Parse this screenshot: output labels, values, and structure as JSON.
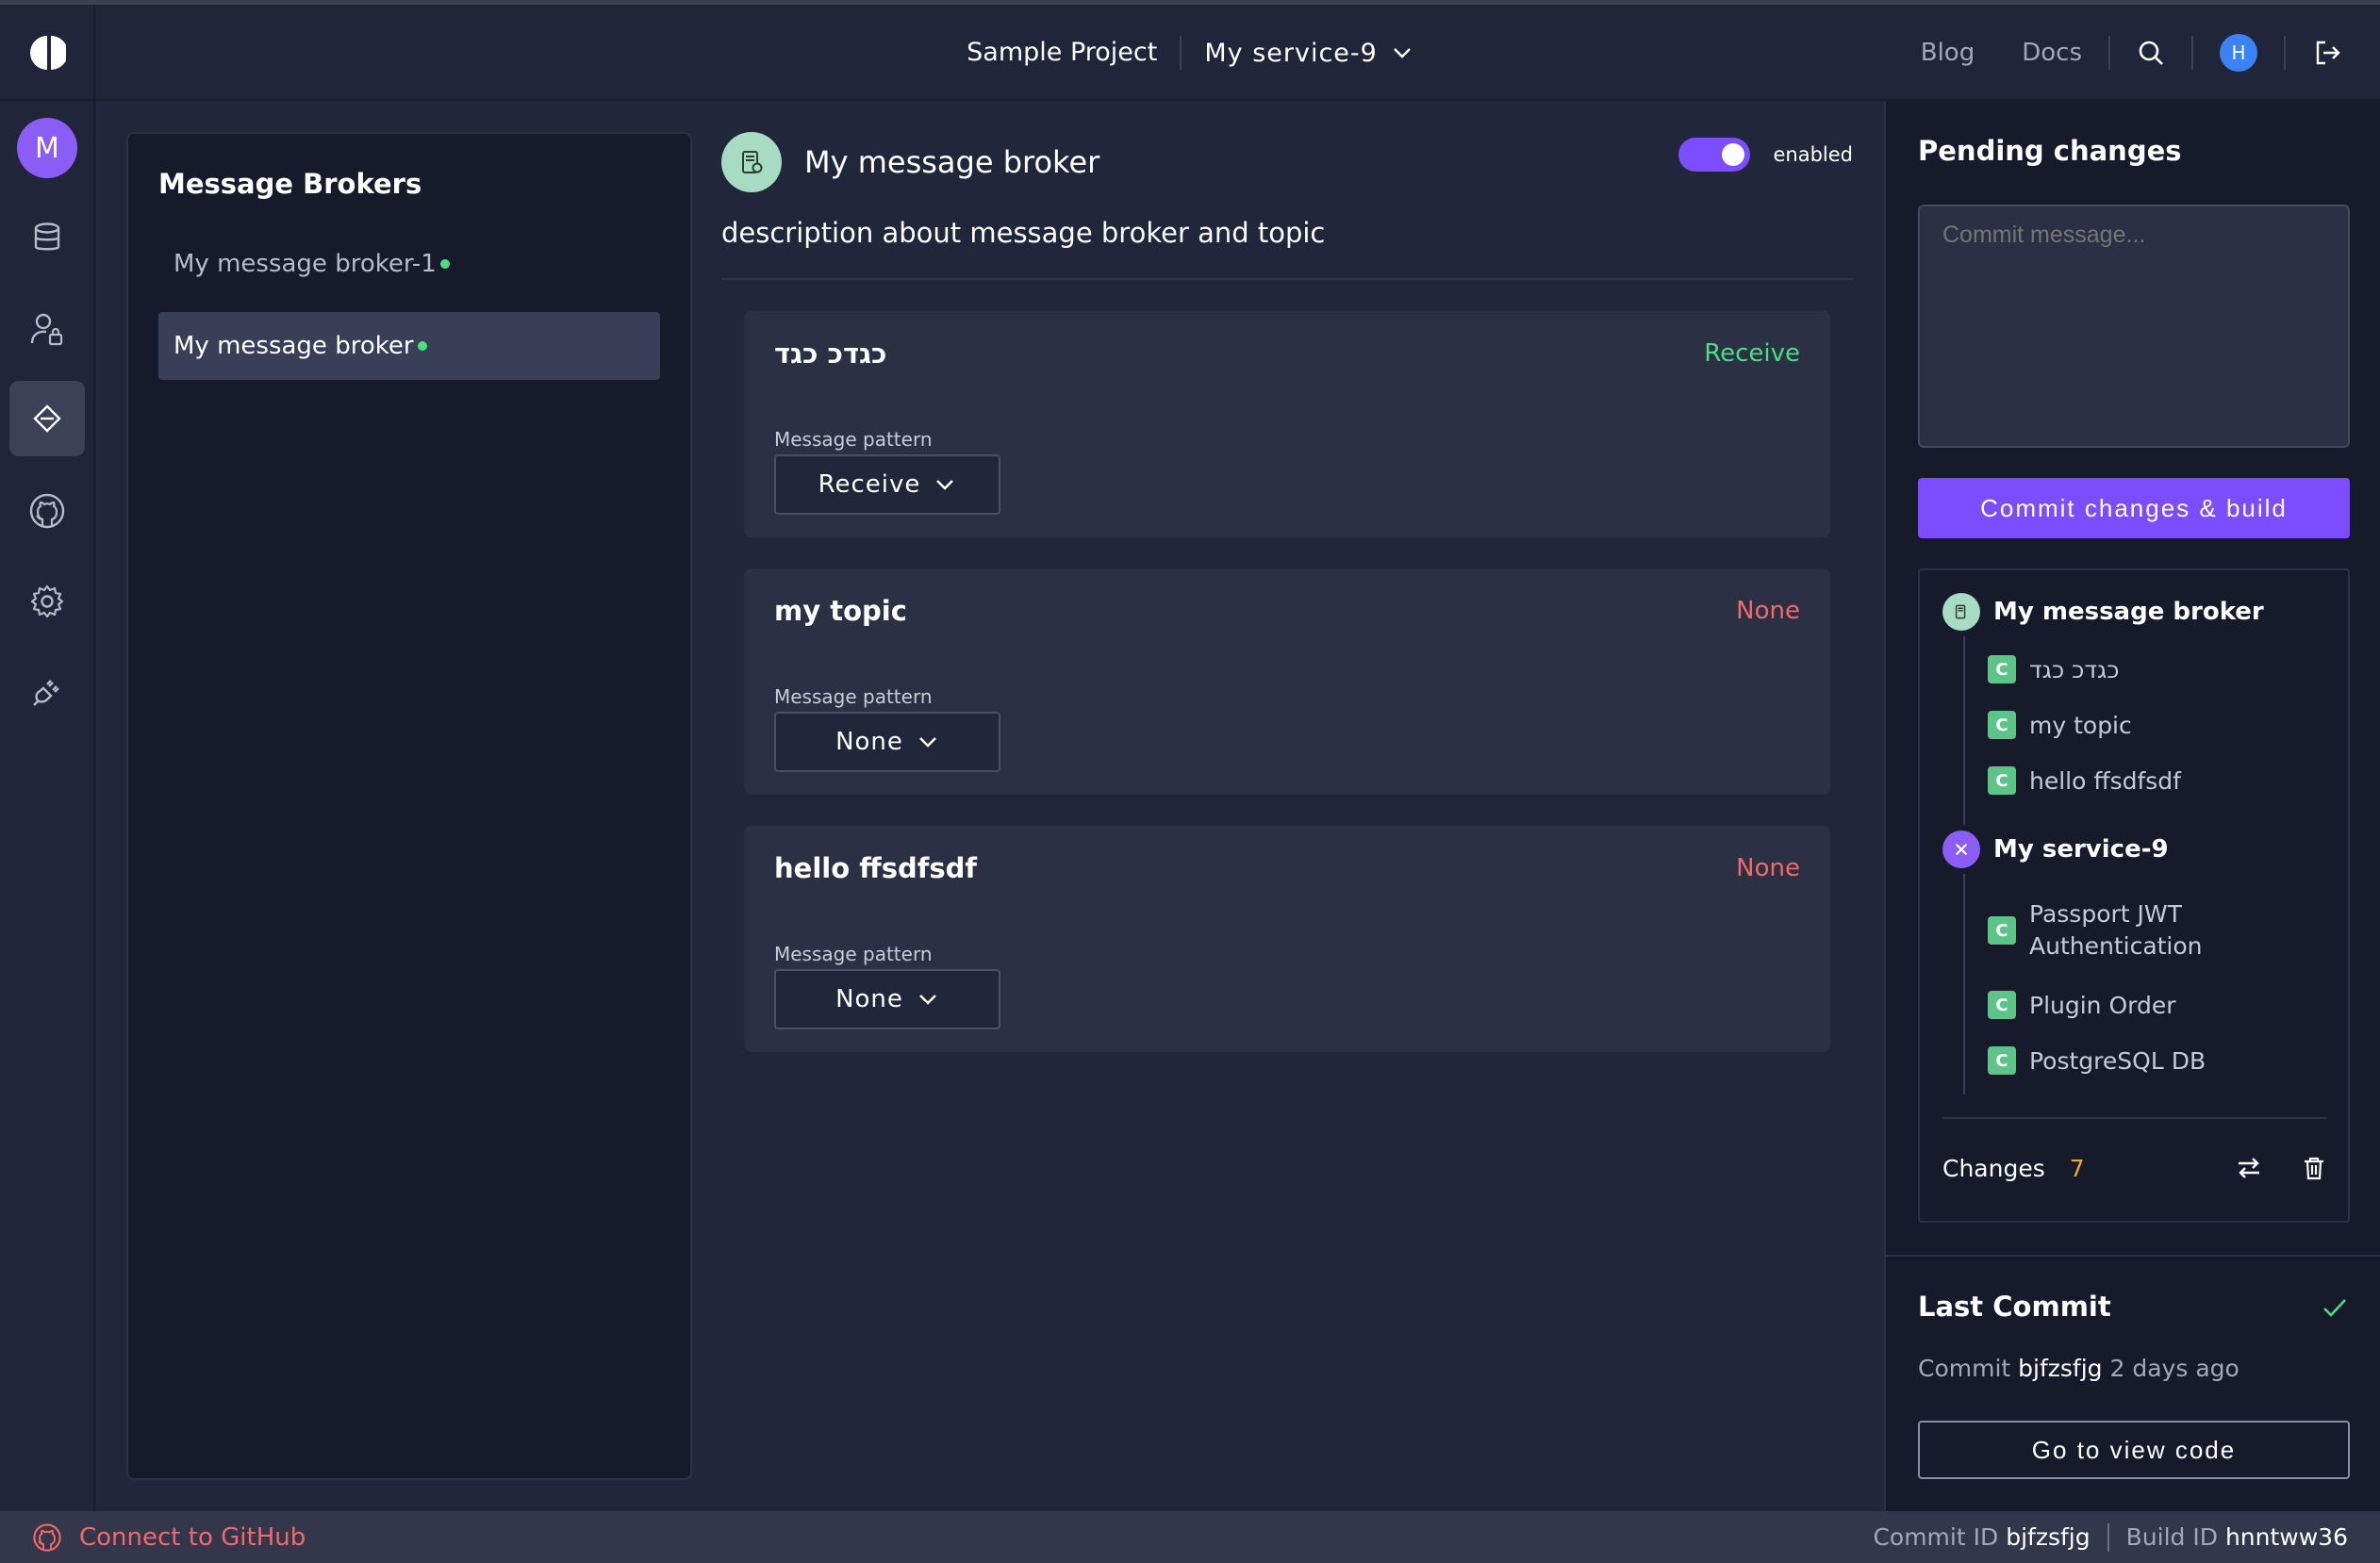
{
  "header": {
    "project_name": "Sample Project",
    "service_name": "My service-9",
    "links": [
      "Blog",
      "Docs"
    ],
    "user_initial": "H"
  },
  "sidebar": {
    "user_initial": "M",
    "items": [
      "database-icon",
      "user-lock-icon",
      "message-broker-icon",
      "github-icon",
      "settings-icon",
      "plugin-icon"
    ]
  },
  "brokers": {
    "title": "Message Brokers",
    "items": [
      {
        "label": "My message broker-1",
        "active": false
      },
      {
        "label": "My message broker",
        "active": true
      }
    ]
  },
  "broker": {
    "title": "My message broker",
    "enabled_label": "enabled",
    "description": "description about message broker and topic",
    "topics": [
      {
        "name": "כגדכ כגד",
        "status": "Receive",
        "pattern_label": "Message pattern",
        "pattern": "Receive"
      },
      {
        "name": "my topic",
        "status": "None",
        "pattern_label": "Message pattern",
        "pattern": "None"
      },
      {
        "name": "hello ffsdfsdf",
        "status": "None",
        "pattern_label": "Message pattern",
        "pattern": "None"
      }
    ]
  },
  "pending": {
    "title": "Pending changes",
    "commit_placeholder": "Commit message...",
    "commit_button": "Commit changes & build",
    "groups": [
      {
        "name": "My message broker",
        "items": [
          "כגדכ כגד",
          "my topic",
          "hello ffsdfsdf"
        ]
      },
      {
        "name": "My service-9",
        "items": [
          "Passport JWT",
          "Authentication",
          "Plugin Order",
          "PostgreSQL DB"
        ]
      }
    ],
    "badge_letter": "C",
    "changes_label": "Changes",
    "changes_count": "7"
  },
  "last_commit": {
    "title": "Last Commit",
    "commit_label": "Commit",
    "hash": "bjfzsfjg",
    "time": "2 days ago",
    "view_code": "Go to view code"
  },
  "footer": {
    "connect_github": "Connect to GitHub",
    "commit_id_label": "Commit ID",
    "commit_id": "bjfzsfjg",
    "build_id_label": "Build ID",
    "build_id": "hnntww36"
  },
  "colors": {
    "accent": "#7c4dff",
    "success": "#4ade80",
    "danger": "#f06a6a",
    "warning": "#f5a623"
  }
}
